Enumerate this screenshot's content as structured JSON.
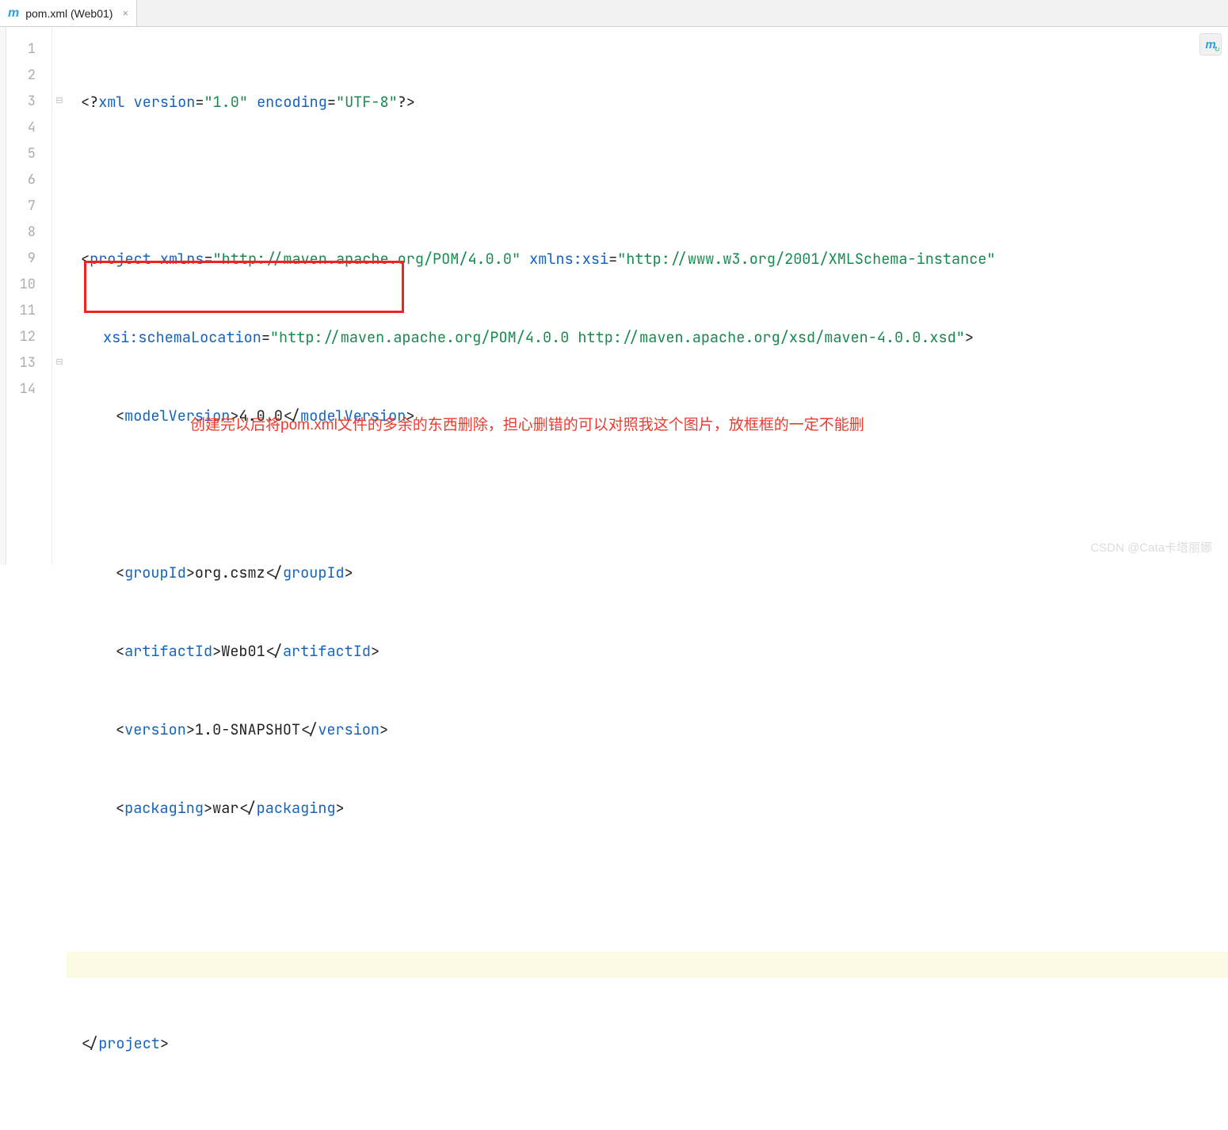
{
  "tab": {
    "icon": "m",
    "title": "pom.xml (Web01)",
    "close": "×"
  },
  "lines": [
    "1",
    "2",
    "3",
    "4",
    "5",
    "6",
    "7",
    "8",
    "9",
    "10",
    "11",
    "12",
    "13",
    "14"
  ],
  "fold": {
    "open": "⊟",
    "mid": "",
    "close": "⊟"
  },
  "code": {
    "l1": {
      "p1": "<?",
      "tag": "xml",
      "sp": " ",
      "a1": "version",
      "eq": "=",
      "v1": "\"1.0\"",
      "sp2": " ",
      "a2": "encoding",
      "v2": "\"UTF-8\"",
      "p2": "?>"
    },
    "l3": {
      "p1": "<",
      "tag": "project",
      "sp": " ",
      "a1": "xmlns",
      "eq": "=",
      "v1": "\"http://maven.apache.org/POM/4.0.0\"",
      "sp2": " ",
      "a2": "xmlns:xsi",
      "v2": "\"http://www.w3.org/2001/XMLSchema-instance\""
    },
    "l4": {
      "a1": "xsi:schemaLocation",
      "eq": "=",
      "v1": "\"http://maven.apache.org/POM/4.0.0 http://maven.apache.org/xsd/maven-4.0.0.xsd\"",
      "gt": ">"
    },
    "l5": {
      "o": "<",
      "t": "modelVersion",
      "g": ">",
      "x": "4.0.0",
      "c": "</",
      "t2": "modelVersion",
      "g2": ">"
    },
    "l7": {
      "o": "<",
      "t": "groupId",
      "g": ">",
      "x": "org.csmz",
      "c": "</",
      "t2": "groupId",
      "g2": ">"
    },
    "l8": {
      "o": "<",
      "t": "artifactId",
      "g": ">",
      "x": "Web01",
      "c": "</",
      "t2": "artifactId",
      "g2": ">"
    },
    "l9": {
      "o": "<",
      "t": "version",
      "g": ">",
      "x": "1.0-SNAPSHOT",
      "c": "</",
      "t2": "version",
      "g2": ">"
    },
    "l10": {
      "o": "<",
      "t": "packaging",
      "g": ">",
      "x": "war",
      "c": "</",
      "t2": "packaging",
      "g2": ">"
    },
    "l13": {
      "c": "</",
      "t": "project",
      "g": ">"
    }
  },
  "annotation": "创建完以后将pom.xml文件的多余的东西删除，担心删错的可以对照我这个图片，放框框的一定不能删",
  "watermark": "CSDN @Cata卡塔丽娜",
  "badge": {
    "m": "m",
    "sync": "↻"
  }
}
